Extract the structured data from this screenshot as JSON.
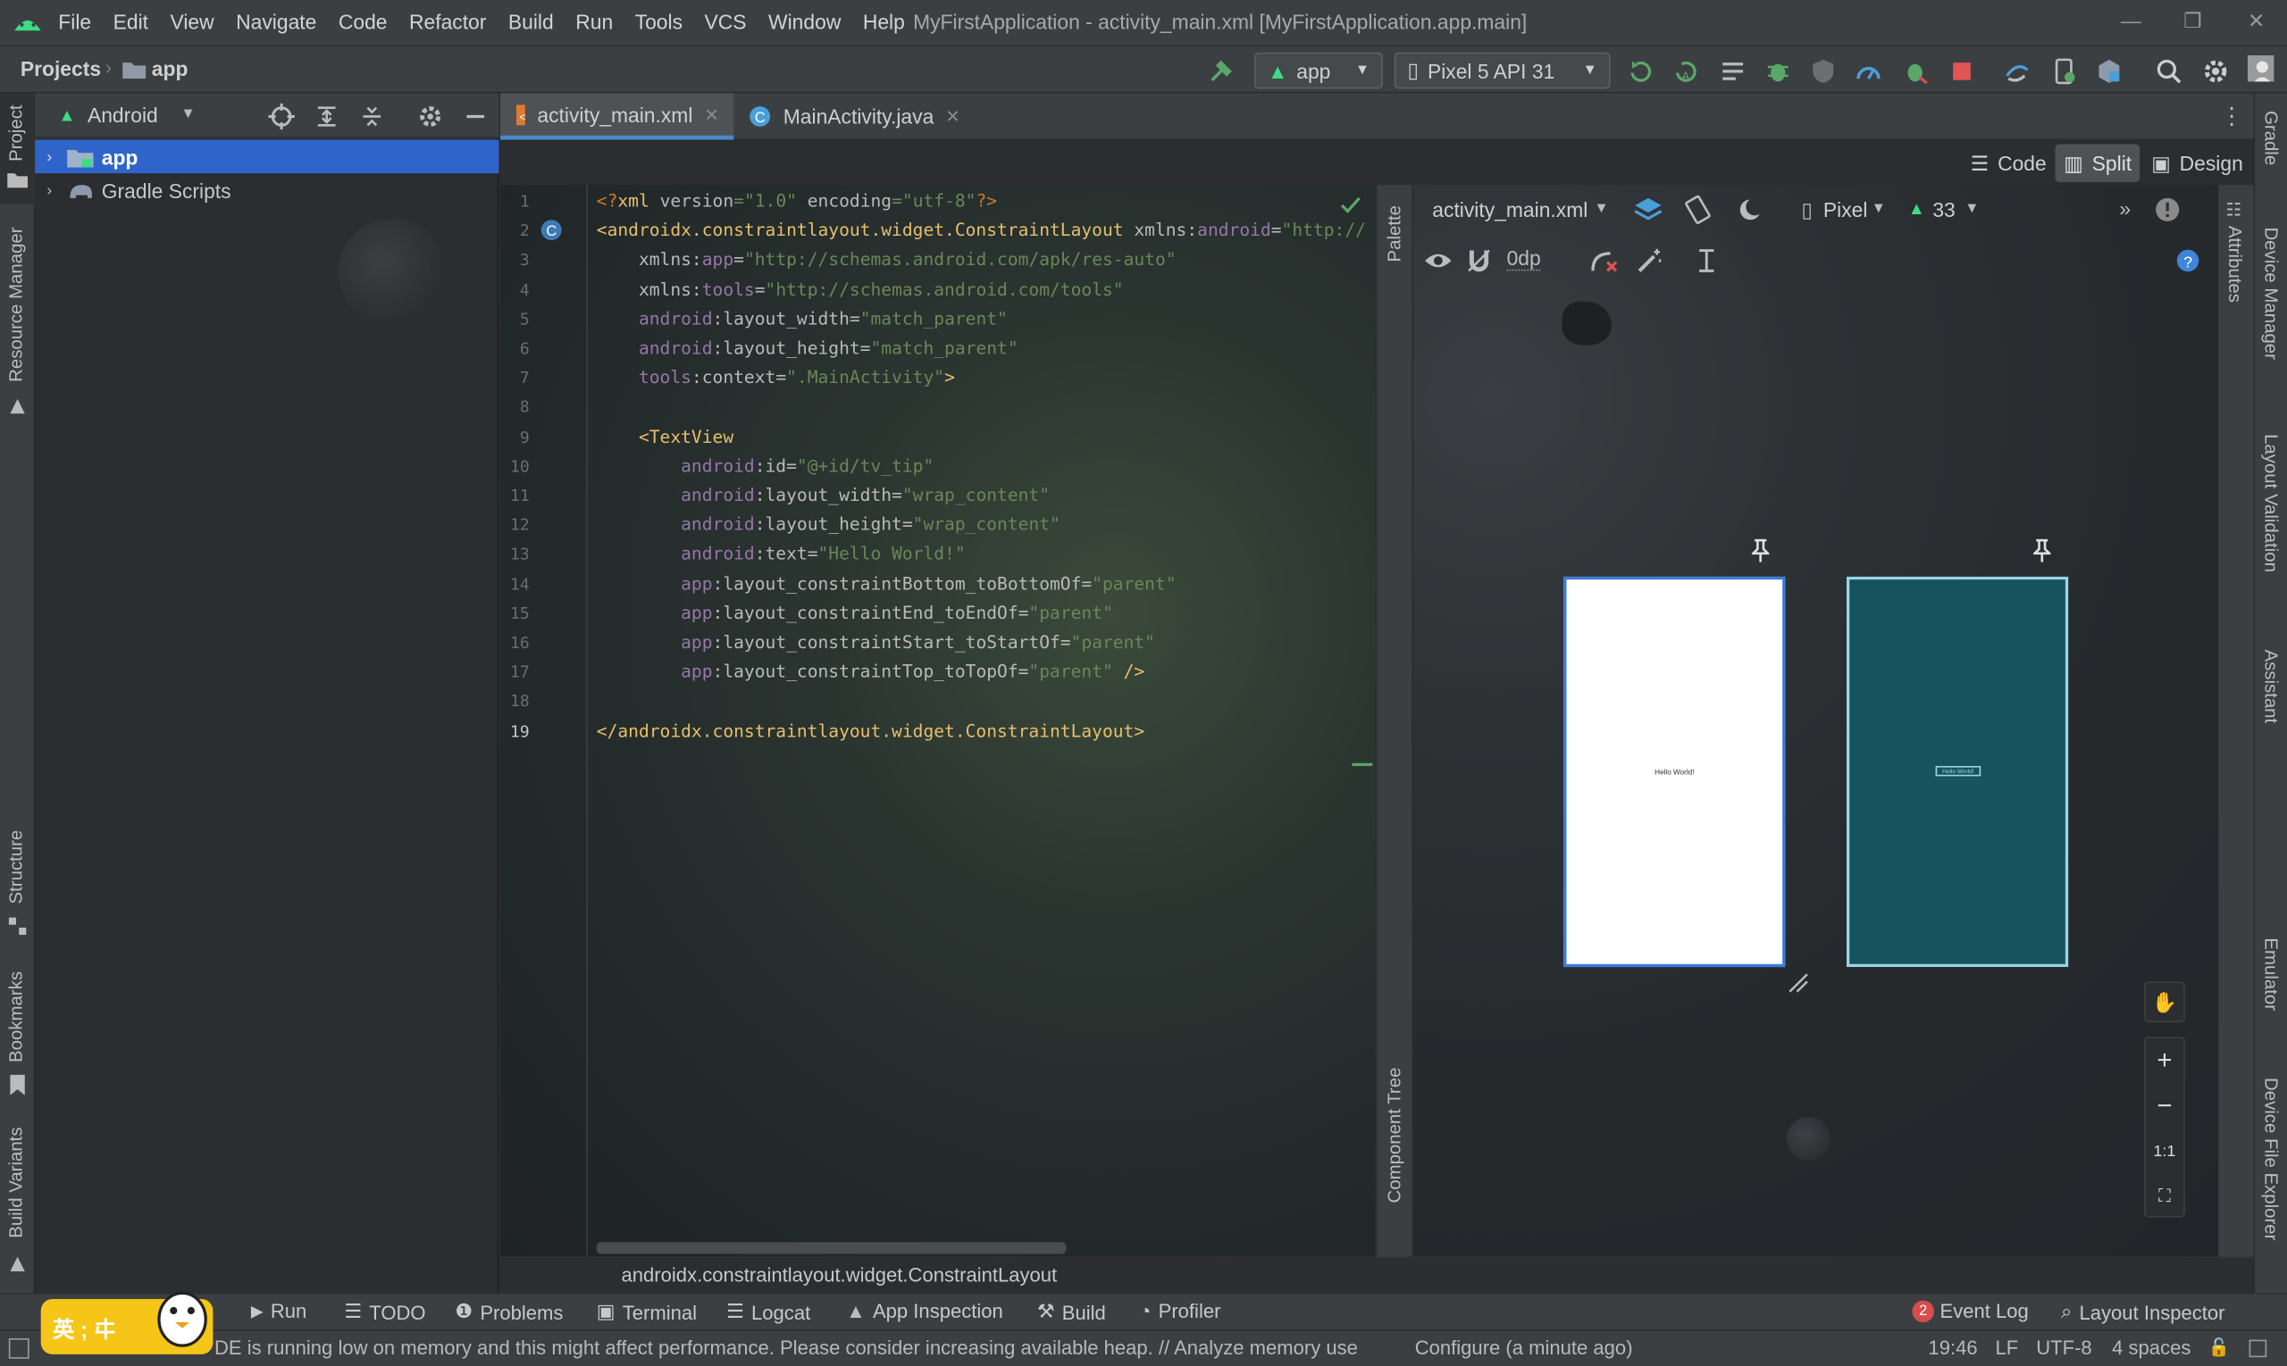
{
  "menubar": {
    "items": [
      "File",
      "Edit",
      "View",
      "Navigate",
      "Code",
      "Refactor",
      "Build",
      "Run",
      "Tools",
      "VCS",
      "Window",
      "Help"
    ],
    "title": "MyFirstApplication - activity_main.xml [MyFirstApplication.app.main]"
  },
  "navbar": {
    "breadcrumb_root": "Projects",
    "breadcrumb_module": "app",
    "run_config": "app",
    "device": "Pixel 5 API 31"
  },
  "project_panel": {
    "view_mode": "Android",
    "tree": [
      {
        "label": "app",
        "selected": true
      },
      {
        "label": "Gradle Scripts",
        "selected": false
      }
    ]
  },
  "left_stripe": {
    "top": [
      "Project",
      "Resource Manager"
    ],
    "bottom": [
      "Structure",
      "Bookmarks",
      "Build Variants"
    ]
  },
  "right_stripe": [
    "Gradle",
    "Device Manager",
    "Layout Validation",
    "Assistant",
    "Emulator",
    "Device File Explorer"
  ],
  "tabs": [
    {
      "label": "activity_main.xml",
      "active": true
    },
    {
      "label": "MainActivity.java",
      "active": false
    }
  ],
  "view_modes": {
    "code": "Code",
    "split": "Split",
    "design": "Design",
    "active": "Split"
  },
  "editor": {
    "line_numbers": [
      "1",
      "2",
      "3",
      "4",
      "5",
      "6",
      "7",
      "8",
      "9",
      "10",
      "11",
      "12",
      "13",
      "14",
      "15",
      "16",
      "17",
      "18",
      "19"
    ],
    "lines": [
      [
        [
          "p",
          "<?"
        ],
        [
          "k",
          "xml "
        ],
        [
          "a",
          "version"
        ],
        [
          "v",
          "=\"1.0\""
        ],
        [
          "a",
          " encoding"
        ],
        [
          "v",
          "=\"utf-8\""
        ],
        [
          "p",
          "?>"
        ]
      ],
      [
        [
          "k",
          "<androidx.constraintlayout.widget.ConstraintLayout "
        ],
        [
          "a",
          "xmlns:"
        ],
        [
          "ns",
          "android"
        ],
        [
          "a",
          "="
        ],
        [
          "v",
          "\"http://"
        ]
      ],
      [
        [
          "a",
          "    xmlns:"
        ],
        [
          "ns",
          "app"
        ],
        [
          "a",
          "="
        ],
        [
          "v",
          "\"http://schemas.android.com/apk/res-auto\""
        ]
      ],
      [
        [
          "a",
          "    xmlns:"
        ],
        [
          "ns",
          "tools"
        ],
        [
          "a",
          "="
        ],
        [
          "v",
          "\"http://schemas.android.com/tools\""
        ]
      ],
      [
        [
          "ns",
          "    android"
        ],
        [
          "a",
          ":layout_width="
        ],
        [
          "v",
          "\"match_parent\""
        ]
      ],
      [
        [
          "ns",
          "    android"
        ],
        [
          "a",
          ":layout_height="
        ],
        [
          "v",
          "\"match_parent\""
        ]
      ],
      [
        [
          "ns",
          "    tools"
        ],
        [
          "a",
          ":context="
        ],
        [
          "v",
          "\".MainActivity\""
        ],
        [
          "k",
          ">"
        ]
      ],
      [
        [
          "a",
          ""
        ]
      ],
      [
        [
          "k",
          "    <TextView"
        ]
      ],
      [
        [
          "ns",
          "        android"
        ],
        [
          "a",
          ":id="
        ],
        [
          "v",
          "\"@+id/tv_tip\""
        ]
      ],
      [
        [
          "ns",
          "        android"
        ],
        [
          "a",
          ":layout_width="
        ],
        [
          "v",
          "\"wrap_content\""
        ]
      ],
      [
        [
          "ns",
          "        android"
        ],
        [
          "a",
          ":layout_height="
        ],
        [
          "v",
          "\"wrap_content\""
        ]
      ],
      [
        [
          "ns",
          "        android"
        ],
        [
          "a",
          ":text="
        ],
        [
          "v",
          "\"Hello World!\""
        ]
      ],
      [
        [
          "ns",
          "        app"
        ],
        [
          "a",
          ":layout_constraintBottom_toBottomOf="
        ],
        [
          "v",
          "\"parent\""
        ]
      ],
      [
        [
          "ns",
          "        app"
        ],
        [
          "a",
          ":layout_constraintEnd_toEndOf="
        ],
        [
          "v",
          "\"parent\""
        ]
      ],
      [
        [
          "ns",
          "        app"
        ],
        [
          "a",
          ":layout_constraintStart_toStartOf="
        ],
        [
          "v",
          "\"parent\""
        ]
      ],
      [
        [
          "ns",
          "        app"
        ],
        [
          "a",
          ":layout_constraintTop_toTopOf="
        ],
        [
          "v",
          "\"parent\""
        ],
        [
          "k",
          " />"
        ]
      ],
      [
        [
          "a",
          ""
        ]
      ],
      [
        [
          "k",
          "</androidx.constraintlayout.widget.ConstraintLayout>"
        ]
      ]
    ]
  },
  "palette_label": "Palette",
  "component_tree_label": "Component Tree",
  "attributes_label": "Attributes",
  "design": {
    "file": "activity_main.xml",
    "device": "Pixel",
    "api": "33",
    "margin": "0dp",
    "preview_text": "Hello World!",
    "zoom_fit": "1:1"
  },
  "breadcrumb_bottom": "androidx.constraintlayout.widget.ConstraintLayout",
  "bottom_tools": [
    "Run",
    "TODO",
    "Problems",
    "Terminal",
    "Logcat",
    "App Inspection",
    "Build",
    "Profiler"
  ],
  "event_log": {
    "count": "2",
    "label": "Event Log"
  },
  "layout_inspector": "Layout Inspector",
  "ime_badge": "英 ; 㐄",
  "status": {
    "message": "DE is running low on memory and this might affect performance. Please consider increasing available heap. // Analyze memory use",
    "configure": "Configure (a minute ago)",
    "time": "19:46",
    "line_sep": "LF",
    "encoding": "UTF-8",
    "indent": "4 spaces"
  },
  "colors": {
    "accent": "#3d7bd9",
    "android_green": "#a4c639",
    "selection": "#2f65ca"
  }
}
